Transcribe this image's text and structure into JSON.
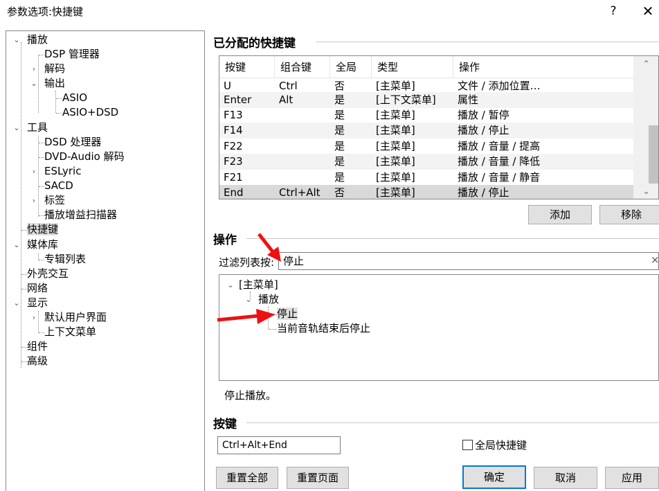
{
  "window": {
    "title": "参数选项:快捷键",
    "help": "?",
    "close": "✕"
  },
  "tree": [
    {
      "label": "播放",
      "toggle": "expanded"
    },
    {
      "label": "DSP 管理器",
      "toggle": ""
    },
    {
      "label": "解码",
      "toggle": "collapsed"
    },
    {
      "label": "输出",
      "toggle": "expanded"
    },
    {
      "label": "ASIO",
      "toggle": ""
    },
    {
      "label": "ASIO+DSD",
      "toggle": ""
    },
    {
      "label": "工具",
      "toggle": "expanded"
    },
    {
      "label": "DSD 处理器",
      "toggle": ""
    },
    {
      "label": "DVD-Audio 解码",
      "toggle": ""
    },
    {
      "label": "ESLyric",
      "toggle": "collapsed"
    },
    {
      "label": "SACD",
      "toggle": ""
    },
    {
      "label": "标签",
      "toggle": "collapsed"
    },
    {
      "label": "播放增益扫描器",
      "toggle": ""
    },
    {
      "label": "快捷键",
      "toggle": "",
      "selected": true
    },
    {
      "label": "媒体库",
      "toggle": "expanded"
    },
    {
      "label": "专辑列表",
      "toggle": ""
    },
    {
      "label": "外壳交互",
      "toggle": ""
    },
    {
      "label": "网络",
      "toggle": ""
    },
    {
      "label": "显示",
      "toggle": "expanded"
    },
    {
      "label": "默认用户界面",
      "toggle": "collapsed"
    },
    {
      "label": "上下文菜单",
      "toggle": ""
    },
    {
      "label": "组件",
      "toggle": ""
    },
    {
      "label": "高级",
      "toggle": ""
    }
  ],
  "assigned": {
    "title": "已分配的快捷键",
    "columns": [
      "按键",
      "组合键",
      "全局",
      "类型",
      "操作"
    ],
    "rows": [
      [
        "U",
        "Ctrl",
        "否",
        "[主菜单]",
        "文件 / 添加位置…"
      ],
      [
        "Enter",
        "Alt",
        "是",
        "[上下文菜单]",
        "属性"
      ],
      [
        "F13",
        "",
        "是",
        "[主菜单]",
        "播放 / 暂停"
      ],
      [
        "F14",
        "",
        "是",
        "[主菜单]",
        "播放 / 停止"
      ],
      [
        "F22",
        "",
        "是",
        "[主菜单]",
        "播放 / 音量 / 提高"
      ],
      [
        "F23",
        "",
        "是",
        "[主菜单]",
        "播放 / 音量 / 降低"
      ],
      [
        "F21",
        "",
        "是",
        "[主菜单]",
        "播放 / 音量 / 静音"
      ],
      [
        "End",
        "Ctrl+Alt",
        "否",
        "[主菜单]",
        "播放 / 停止"
      ]
    ],
    "add_label": "添加",
    "remove_label": "移除"
  },
  "action": {
    "title": "操作",
    "filter_label": "过滤列表按:",
    "filter_value": "停止",
    "clear": "×",
    "tree": [
      {
        "label": "[主菜单]"
      },
      {
        "label": "播放"
      },
      {
        "label": "停止"
      },
      {
        "label": "当前音轨结束后停止"
      }
    ],
    "description": "停止播放。"
  },
  "key": {
    "title": "按键",
    "value": "Ctrl+Alt+End",
    "global_label": "全局快捷键"
  },
  "buttons": {
    "reset_all": "重置全部",
    "reset_page": "重置页面",
    "ok": "确定",
    "cancel": "取消",
    "apply": "应用"
  }
}
